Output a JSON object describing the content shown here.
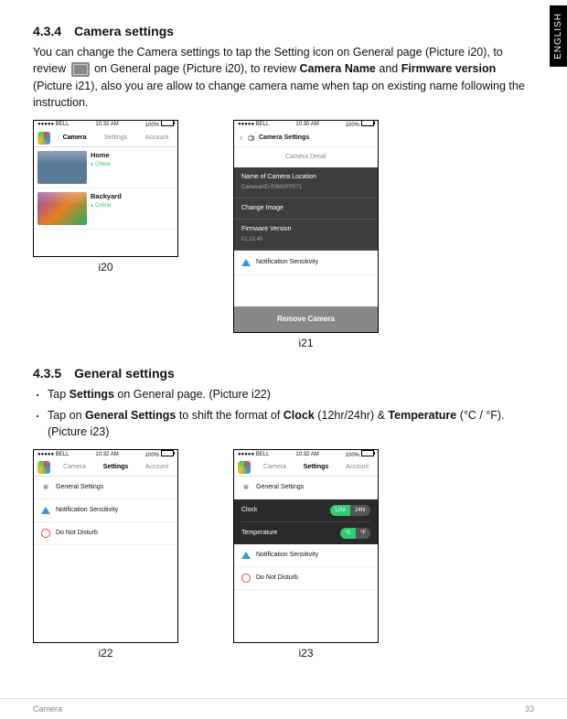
{
  "lang_tab": "ENGLISH",
  "section1": {
    "num": "4.3.4",
    "title": "Camera settings",
    "body": "You can change the Camera settings to tap the Setting icon {icon} on General page (Picture i20), to review ",
    "bold1": "Camera Name",
    "mid": " and ",
    "bold2": "Firmware version",
    "tail": " (Picture i21), also you are allow to change camera name when tap on existing name following the instruction."
  },
  "section2": {
    "num": "4.3.5",
    "title": "General settings",
    "bullet1a": "Tap ",
    "bullet1b": "Settings",
    "bullet1c": " on General page. (Picture i22)",
    "bullet2a": "Tap on ",
    "bullet2b": "General Settings",
    "bullet2c": " to shift the format of ",
    "bullet2d": "Clock",
    "bullet2e": " (12hr/24hr) & ",
    "bullet2f": "Temperature",
    "bullet2g": " (°C / °F). (Picture i23)"
  },
  "status": {
    "carrier": "●●●●● BELL",
    "wifi": "ᯤ",
    "time1": "10:32 AM",
    "time2": "10:30 AM",
    "battpct": "100%"
  },
  "tabs": {
    "camera": "Camera",
    "settings": "Settings",
    "account": "Account"
  },
  "i20": {
    "cap": "i20",
    "cam1": {
      "name": "Home",
      "status": "Online"
    },
    "cam2": {
      "name": "Backyard",
      "status": "Online"
    }
  },
  "i21": {
    "cap": "i21",
    "title": "Camera Settings",
    "detail": "Camera Detail",
    "nameLabel": "Name of Camera Location",
    "nameVal": "CameraHD-00665FF071",
    "changeImg": "Change Image",
    "fwLabel": "Firmware Version",
    "fwVal": "01.13.40",
    "notif": "Notification Sensitivity",
    "remove": "Remove Camera"
  },
  "i22": {
    "cap": "i22",
    "general": "General Settings",
    "notif": "Notification Sensitivity",
    "dnd": "Do Not Disturb"
  },
  "i23": {
    "cap": "i23",
    "general": "General Settings",
    "clock": "Clock",
    "clk12": "12hr",
    "clk24": "24hr",
    "temp": "Temperature",
    "tC": "°C",
    "tF": "°F",
    "notif": "Notification Sensitivity",
    "dnd": "Do Not Disturb"
  },
  "footer": {
    "left": "Camera",
    "right": "33"
  }
}
